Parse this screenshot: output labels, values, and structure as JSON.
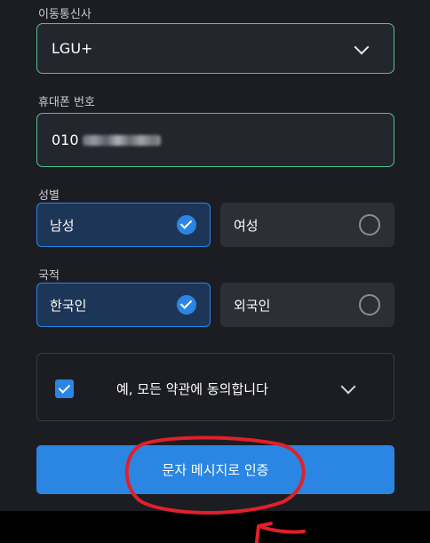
{
  "carrier": {
    "label": "이동통신사",
    "value": "LGU+"
  },
  "phone": {
    "label": "휴대폰 번호",
    "value_prefix": "010"
  },
  "gender": {
    "label": "성별",
    "options": [
      {
        "label": "남성",
        "selected": true
      },
      {
        "label": "여성",
        "selected": false
      }
    ]
  },
  "nationality": {
    "label": "국적",
    "options": [
      {
        "label": "한국인",
        "selected": true
      },
      {
        "label": "외국인",
        "selected": false
      }
    ]
  },
  "agreement": {
    "label": "예, 모든 약관에 동의합니다",
    "checked": true
  },
  "submit": {
    "label": "문자 메시지로 인증"
  },
  "colors": {
    "background": "#1c1d23",
    "field_border": "#4cc28e",
    "accent": "#2a86e2",
    "annotation": "#e0202a"
  },
  "icons": {
    "carrier_dropdown": "chevron-down-icon",
    "selected_option": "check-circle-icon",
    "unselected_option": "empty-radio-icon",
    "agreement_checkbox": "checkbox-checked-icon",
    "agreement_expand": "chevron-down-icon"
  }
}
